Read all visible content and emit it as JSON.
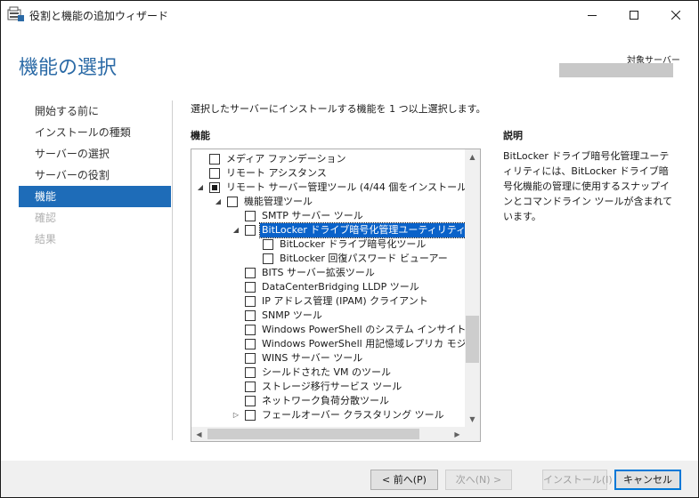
{
  "window": {
    "title": "役割と機能の追加ウィザード"
  },
  "header": {
    "page_title": "機能の選択",
    "target_server_label": "対象サーバー",
    "target_server_value": ""
  },
  "nav": {
    "items": [
      {
        "label": "開始する前に",
        "state": "normal"
      },
      {
        "label": "インストールの種類",
        "state": "normal"
      },
      {
        "label": "サーバーの選択",
        "state": "normal"
      },
      {
        "label": "サーバーの役割",
        "state": "normal"
      },
      {
        "label": "機能",
        "state": "active"
      },
      {
        "label": "確認",
        "state": "disabled"
      },
      {
        "label": "結果",
        "state": "disabled"
      }
    ]
  },
  "main": {
    "instruction": "選択したサーバーにインストールする機能を 1 つ以上選択します。",
    "features_heading": "機能",
    "description_heading": "説明",
    "description_text": "BitLocker ドライブ暗号化管理ユーティリティには、BitLocker ドライブ暗号化機能の管理に使用するスナップインとコマンドライン ツールが含まれています。"
  },
  "tree": {
    "rows": [
      {
        "label": "メディア ファンデーション",
        "level": 0,
        "expander": "",
        "checkbox": "unchecked",
        "selected": false
      },
      {
        "label": "リモート アシスタンス",
        "level": 0,
        "expander": "",
        "checkbox": "unchecked",
        "selected": false
      },
      {
        "label": "リモート サーバー管理ツール (4/44 個をインストール済み)",
        "level": 0,
        "expander": "expanded",
        "checkbox": "partial",
        "selected": false
      },
      {
        "label": "機能管理ツール",
        "level": 1,
        "expander": "expanded",
        "checkbox": "unchecked",
        "selected": false
      },
      {
        "label": "SMTP サーバー ツール",
        "level": 2,
        "expander": "",
        "checkbox": "unchecked",
        "selected": false
      },
      {
        "label": "BitLocker ドライブ暗号化管理ユーティリティ",
        "level": 2,
        "expander": "expanded",
        "checkbox": "unchecked",
        "selected": true
      },
      {
        "label": "BitLocker ドライブ暗号化ツール",
        "level": 3,
        "expander": "",
        "checkbox": "unchecked",
        "selected": false
      },
      {
        "label": "BitLocker 回復パスワード ビューアー",
        "level": 3,
        "expander": "",
        "checkbox": "unchecked",
        "selected": false
      },
      {
        "label": "BITS サーバー拡張ツール",
        "level": 2,
        "expander": "",
        "checkbox": "unchecked",
        "selected": false
      },
      {
        "label": "DataCenterBridging LLDP ツール",
        "level": 2,
        "expander": "",
        "checkbox": "unchecked",
        "selected": false
      },
      {
        "label": "IP アドレス管理 (IPAM) クライアント",
        "level": 2,
        "expander": "",
        "checkbox": "unchecked",
        "selected": false
      },
      {
        "label": "SNMP ツール",
        "level": 2,
        "expander": "",
        "checkbox": "unchecked",
        "selected": false
      },
      {
        "label": "Windows PowerShell のシステム インサイト モジュール",
        "level": 2,
        "expander": "",
        "checkbox": "unchecked",
        "selected": false
      },
      {
        "label": "Windows PowerShell 用記憶域レプリカ モジュール",
        "level": 2,
        "expander": "",
        "checkbox": "unchecked",
        "selected": false
      },
      {
        "label": "WINS サーバー ツール",
        "level": 2,
        "expander": "",
        "checkbox": "unchecked",
        "selected": false
      },
      {
        "label": "シールドされた VM のツール",
        "level": 2,
        "expander": "",
        "checkbox": "unchecked",
        "selected": false
      },
      {
        "label": "ストレージ移行サービス ツール",
        "level": 2,
        "expander": "",
        "checkbox": "unchecked",
        "selected": false
      },
      {
        "label": "ネットワーク負荷分散ツール",
        "level": 2,
        "expander": "",
        "checkbox": "unchecked",
        "selected": false
      },
      {
        "label": "フェールオーバー クラスタリング ツール",
        "level": 2,
        "expander": "collapsed",
        "checkbox": "unchecked",
        "selected": false
      }
    ]
  },
  "footer": {
    "prev_label": "< 前へ(P)",
    "next_label": "次へ(N) >",
    "install_label": "インストール(I)",
    "cancel_label": "キャンセル"
  },
  "colors": {
    "accent": "#1e6cb8",
    "title_blue": "#2b6aa6",
    "selection": "#0a62c9"
  }
}
